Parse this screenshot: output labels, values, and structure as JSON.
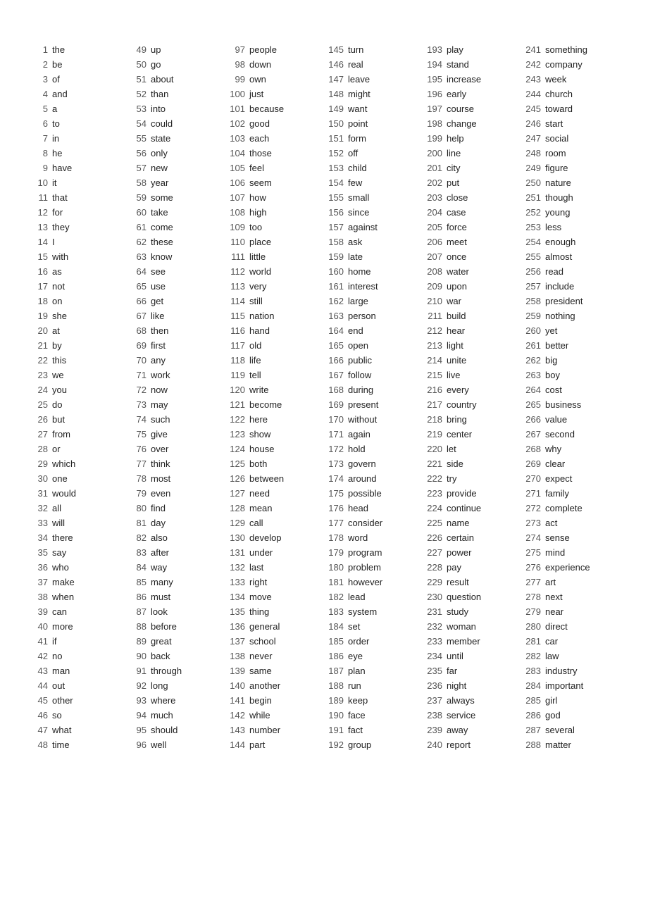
{
  "words": [
    {
      "num": 1,
      "word": "the"
    },
    {
      "num": 2,
      "word": "be"
    },
    {
      "num": 3,
      "word": "of"
    },
    {
      "num": 4,
      "word": "and"
    },
    {
      "num": 5,
      "word": "a"
    },
    {
      "num": 6,
      "word": "to"
    },
    {
      "num": 7,
      "word": "in"
    },
    {
      "num": 8,
      "word": "he"
    },
    {
      "num": 9,
      "word": "have"
    },
    {
      "num": 10,
      "word": "it"
    },
    {
      "num": 11,
      "word": "that"
    },
    {
      "num": 12,
      "word": "for"
    },
    {
      "num": 13,
      "word": "they"
    },
    {
      "num": 14,
      "word": "I"
    },
    {
      "num": 15,
      "word": "with"
    },
    {
      "num": 16,
      "word": "as"
    },
    {
      "num": 17,
      "word": "not"
    },
    {
      "num": 18,
      "word": "on"
    },
    {
      "num": 19,
      "word": "she"
    },
    {
      "num": 20,
      "word": "at"
    },
    {
      "num": 21,
      "word": "by"
    },
    {
      "num": 22,
      "word": "this"
    },
    {
      "num": 23,
      "word": "we"
    },
    {
      "num": 24,
      "word": "you"
    },
    {
      "num": 25,
      "word": "do"
    },
    {
      "num": 26,
      "word": "but"
    },
    {
      "num": 27,
      "word": "from"
    },
    {
      "num": 28,
      "word": "or"
    },
    {
      "num": 29,
      "word": "which"
    },
    {
      "num": 30,
      "word": "one"
    },
    {
      "num": 31,
      "word": "would"
    },
    {
      "num": 32,
      "word": "all"
    },
    {
      "num": 33,
      "word": "will"
    },
    {
      "num": 34,
      "word": "there"
    },
    {
      "num": 35,
      "word": "say"
    },
    {
      "num": 36,
      "word": "who"
    },
    {
      "num": 37,
      "word": "make"
    },
    {
      "num": 38,
      "word": "when"
    },
    {
      "num": 39,
      "word": "can"
    },
    {
      "num": 40,
      "word": "more"
    },
    {
      "num": 41,
      "word": "if"
    },
    {
      "num": 42,
      "word": "no"
    },
    {
      "num": 43,
      "word": "man"
    },
    {
      "num": 44,
      "word": "out"
    },
    {
      "num": 45,
      "word": "other"
    },
    {
      "num": 46,
      "word": "so"
    },
    {
      "num": 47,
      "word": "what"
    },
    {
      "num": 48,
      "word": "time"
    },
    {
      "num": 49,
      "word": "up"
    },
    {
      "num": 50,
      "word": "go"
    },
    {
      "num": 51,
      "word": "about"
    },
    {
      "num": 52,
      "word": "than"
    },
    {
      "num": 53,
      "word": "into"
    },
    {
      "num": 54,
      "word": "could"
    },
    {
      "num": 55,
      "word": "state"
    },
    {
      "num": 56,
      "word": "only"
    },
    {
      "num": 57,
      "word": "new"
    },
    {
      "num": 58,
      "word": "year"
    },
    {
      "num": 59,
      "word": "some"
    },
    {
      "num": 60,
      "word": "take"
    },
    {
      "num": 61,
      "word": "come"
    },
    {
      "num": 62,
      "word": "these"
    },
    {
      "num": 63,
      "word": "know"
    },
    {
      "num": 64,
      "word": "see"
    },
    {
      "num": 65,
      "word": "use"
    },
    {
      "num": 66,
      "word": "get"
    },
    {
      "num": 67,
      "word": "like"
    },
    {
      "num": 68,
      "word": "then"
    },
    {
      "num": 69,
      "word": "first"
    },
    {
      "num": 70,
      "word": "any"
    },
    {
      "num": 71,
      "word": "work"
    },
    {
      "num": 72,
      "word": "now"
    },
    {
      "num": 73,
      "word": "may"
    },
    {
      "num": 74,
      "word": "such"
    },
    {
      "num": 75,
      "word": "give"
    },
    {
      "num": 76,
      "word": "over"
    },
    {
      "num": 77,
      "word": "think"
    },
    {
      "num": 78,
      "word": "most"
    },
    {
      "num": 79,
      "word": "even"
    },
    {
      "num": 80,
      "word": "find"
    },
    {
      "num": 81,
      "word": "day"
    },
    {
      "num": 82,
      "word": "also"
    },
    {
      "num": 83,
      "word": "after"
    },
    {
      "num": 84,
      "word": "way"
    },
    {
      "num": 85,
      "word": "many"
    },
    {
      "num": 86,
      "word": "must"
    },
    {
      "num": 87,
      "word": "look"
    },
    {
      "num": 88,
      "word": "before"
    },
    {
      "num": 89,
      "word": "great"
    },
    {
      "num": 90,
      "word": "back"
    },
    {
      "num": 91,
      "word": "through"
    },
    {
      "num": 92,
      "word": "long"
    },
    {
      "num": 93,
      "word": "where"
    },
    {
      "num": 94,
      "word": "much"
    },
    {
      "num": 95,
      "word": "should"
    },
    {
      "num": 96,
      "word": "well"
    },
    {
      "num": 97,
      "word": "people"
    },
    {
      "num": 98,
      "word": "down"
    },
    {
      "num": 99,
      "word": "own"
    },
    {
      "num": 100,
      "word": "just"
    },
    {
      "num": 101,
      "word": "because"
    },
    {
      "num": 102,
      "word": "good"
    },
    {
      "num": 103,
      "word": "each"
    },
    {
      "num": 104,
      "word": "those"
    },
    {
      "num": 105,
      "word": "feel"
    },
    {
      "num": 106,
      "word": "seem"
    },
    {
      "num": 107,
      "word": "how"
    },
    {
      "num": 108,
      "word": "high"
    },
    {
      "num": 109,
      "word": "too"
    },
    {
      "num": 110,
      "word": "place"
    },
    {
      "num": 111,
      "word": "little"
    },
    {
      "num": 112,
      "word": "world"
    },
    {
      "num": 113,
      "word": "very"
    },
    {
      "num": 114,
      "word": "still"
    },
    {
      "num": 115,
      "word": "nation"
    },
    {
      "num": 116,
      "word": "hand"
    },
    {
      "num": 117,
      "word": "old"
    },
    {
      "num": 118,
      "word": "life"
    },
    {
      "num": 119,
      "word": "tell"
    },
    {
      "num": 120,
      "word": "write"
    },
    {
      "num": 121,
      "word": "become"
    },
    {
      "num": 122,
      "word": "here"
    },
    {
      "num": 123,
      "word": "show"
    },
    {
      "num": 124,
      "word": "house"
    },
    {
      "num": 125,
      "word": "both"
    },
    {
      "num": 126,
      "word": "between"
    },
    {
      "num": 127,
      "word": "need"
    },
    {
      "num": 128,
      "word": "mean"
    },
    {
      "num": 129,
      "word": "call"
    },
    {
      "num": 130,
      "word": "develop"
    },
    {
      "num": 131,
      "word": "under"
    },
    {
      "num": 132,
      "word": "last"
    },
    {
      "num": 133,
      "word": "right"
    },
    {
      "num": 134,
      "word": "move"
    },
    {
      "num": 135,
      "word": "thing"
    },
    {
      "num": 136,
      "word": "general"
    },
    {
      "num": 137,
      "word": "school"
    },
    {
      "num": 138,
      "word": "never"
    },
    {
      "num": 139,
      "word": "same"
    },
    {
      "num": 140,
      "word": "another"
    },
    {
      "num": 141,
      "word": "begin"
    },
    {
      "num": 142,
      "word": "while"
    },
    {
      "num": 143,
      "word": "number"
    },
    {
      "num": 144,
      "word": "part"
    },
    {
      "num": 145,
      "word": "turn"
    },
    {
      "num": 146,
      "word": "real"
    },
    {
      "num": 147,
      "word": "leave"
    },
    {
      "num": 148,
      "word": "might"
    },
    {
      "num": 149,
      "word": "want"
    },
    {
      "num": 150,
      "word": "point"
    },
    {
      "num": 151,
      "word": "form"
    },
    {
      "num": 152,
      "word": "off"
    },
    {
      "num": 153,
      "word": "child"
    },
    {
      "num": 154,
      "word": "few"
    },
    {
      "num": 155,
      "word": "small"
    },
    {
      "num": 156,
      "word": "since"
    },
    {
      "num": 157,
      "word": "against"
    },
    {
      "num": 158,
      "word": "ask"
    },
    {
      "num": 159,
      "word": "late"
    },
    {
      "num": 160,
      "word": "home"
    },
    {
      "num": 161,
      "word": "interest"
    },
    {
      "num": 162,
      "word": "large"
    },
    {
      "num": 163,
      "word": "person"
    },
    {
      "num": 164,
      "word": "end"
    },
    {
      "num": 165,
      "word": "open"
    },
    {
      "num": 166,
      "word": "public"
    },
    {
      "num": 167,
      "word": "follow"
    },
    {
      "num": 168,
      "word": "during"
    },
    {
      "num": 169,
      "word": "present"
    },
    {
      "num": 170,
      "word": "without"
    },
    {
      "num": 171,
      "word": "again"
    },
    {
      "num": 172,
      "word": "hold"
    },
    {
      "num": 173,
      "word": "govern"
    },
    {
      "num": 174,
      "word": "around"
    },
    {
      "num": 175,
      "word": "possible"
    },
    {
      "num": 176,
      "word": "head"
    },
    {
      "num": 177,
      "word": "consider"
    },
    {
      "num": 178,
      "word": "word"
    },
    {
      "num": 179,
      "word": "program"
    },
    {
      "num": 180,
      "word": "problem"
    },
    {
      "num": 181,
      "word": "however"
    },
    {
      "num": 182,
      "word": "lead"
    },
    {
      "num": 183,
      "word": "system"
    },
    {
      "num": 184,
      "word": "set"
    },
    {
      "num": 185,
      "word": "order"
    },
    {
      "num": 186,
      "word": "eye"
    },
    {
      "num": 187,
      "word": "plan"
    },
    {
      "num": 188,
      "word": "run"
    },
    {
      "num": 189,
      "word": "keep"
    },
    {
      "num": 190,
      "word": "face"
    },
    {
      "num": 191,
      "word": "fact"
    },
    {
      "num": 192,
      "word": "group"
    },
    {
      "num": 193,
      "word": "play"
    },
    {
      "num": 194,
      "word": "stand"
    },
    {
      "num": 195,
      "word": "increase"
    },
    {
      "num": 196,
      "word": "early"
    },
    {
      "num": 197,
      "word": "course"
    },
    {
      "num": 198,
      "word": "change"
    },
    {
      "num": 199,
      "word": "help"
    },
    {
      "num": 200,
      "word": "line"
    },
    {
      "num": 201,
      "word": "city"
    },
    {
      "num": 202,
      "word": "put"
    },
    {
      "num": 203,
      "word": "close"
    },
    {
      "num": 204,
      "word": "case"
    },
    {
      "num": 205,
      "word": "force"
    },
    {
      "num": 206,
      "word": "meet"
    },
    {
      "num": 207,
      "word": "once"
    },
    {
      "num": 208,
      "word": "water"
    },
    {
      "num": 209,
      "word": "upon"
    },
    {
      "num": 210,
      "word": "war"
    },
    {
      "num": 211,
      "word": "build"
    },
    {
      "num": 212,
      "word": "hear"
    },
    {
      "num": 213,
      "word": "light"
    },
    {
      "num": 214,
      "word": "unite"
    },
    {
      "num": 215,
      "word": "live"
    },
    {
      "num": 216,
      "word": "every"
    },
    {
      "num": 217,
      "word": "country"
    },
    {
      "num": 218,
      "word": "bring"
    },
    {
      "num": 219,
      "word": "center"
    },
    {
      "num": 220,
      "word": "let"
    },
    {
      "num": 221,
      "word": "side"
    },
    {
      "num": 222,
      "word": "try"
    },
    {
      "num": 223,
      "word": "provide"
    },
    {
      "num": 224,
      "word": "continue"
    },
    {
      "num": 225,
      "word": "name"
    },
    {
      "num": 226,
      "word": "certain"
    },
    {
      "num": 227,
      "word": "power"
    },
    {
      "num": 228,
      "word": "pay"
    },
    {
      "num": 229,
      "word": "result"
    },
    {
      "num": 230,
      "word": "question"
    },
    {
      "num": 231,
      "word": "study"
    },
    {
      "num": 232,
      "word": "woman"
    },
    {
      "num": 233,
      "word": "member"
    },
    {
      "num": 234,
      "word": "until"
    },
    {
      "num": 235,
      "word": "far"
    },
    {
      "num": 236,
      "word": "night"
    },
    {
      "num": 237,
      "word": "always"
    },
    {
      "num": 238,
      "word": "service"
    },
    {
      "num": 239,
      "word": "away"
    },
    {
      "num": 240,
      "word": "report"
    },
    {
      "num": 241,
      "word": "something"
    },
    {
      "num": 242,
      "word": "company"
    },
    {
      "num": 243,
      "word": "week"
    },
    {
      "num": 244,
      "word": "church"
    },
    {
      "num": 245,
      "word": "toward"
    },
    {
      "num": 246,
      "word": "start"
    },
    {
      "num": 247,
      "word": "social"
    },
    {
      "num": 248,
      "word": "room"
    },
    {
      "num": 249,
      "word": "figure"
    },
    {
      "num": 250,
      "word": "nature"
    },
    {
      "num": 251,
      "word": "though"
    },
    {
      "num": 252,
      "word": "young"
    },
    {
      "num": 253,
      "word": "less"
    },
    {
      "num": 254,
      "word": "enough"
    },
    {
      "num": 255,
      "word": "almost"
    },
    {
      "num": 256,
      "word": "read"
    },
    {
      "num": 257,
      "word": "include"
    },
    {
      "num": 258,
      "word": "president"
    },
    {
      "num": 259,
      "word": "nothing"
    },
    {
      "num": 260,
      "word": "yet"
    },
    {
      "num": 261,
      "word": "better"
    },
    {
      "num": 262,
      "word": "big"
    },
    {
      "num": 263,
      "word": "boy"
    },
    {
      "num": 264,
      "word": "cost"
    },
    {
      "num": 265,
      "word": "business"
    },
    {
      "num": 266,
      "word": "value"
    },
    {
      "num": 267,
      "word": "second"
    },
    {
      "num": 268,
      "word": "why"
    },
    {
      "num": 269,
      "word": "clear"
    },
    {
      "num": 270,
      "word": "expect"
    },
    {
      "num": 271,
      "word": "family"
    },
    {
      "num": 272,
      "word": "complete"
    },
    {
      "num": 273,
      "word": "act"
    },
    {
      "num": 274,
      "word": "sense"
    },
    {
      "num": 275,
      "word": "mind"
    },
    {
      "num": 276,
      "word": "experience"
    },
    {
      "num": 277,
      "word": "art"
    },
    {
      "num": 278,
      "word": "next"
    },
    {
      "num": 279,
      "word": "near"
    },
    {
      "num": 280,
      "word": "direct"
    },
    {
      "num": 281,
      "word": "car"
    },
    {
      "num": 282,
      "word": "law"
    },
    {
      "num": 283,
      "word": "industry"
    },
    {
      "num": 284,
      "word": "important"
    },
    {
      "num": 285,
      "word": "girl"
    },
    {
      "num": 286,
      "word": "god"
    },
    {
      "num": 287,
      "word": "several"
    },
    {
      "num": 288,
      "word": "matter"
    }
  ]
}
